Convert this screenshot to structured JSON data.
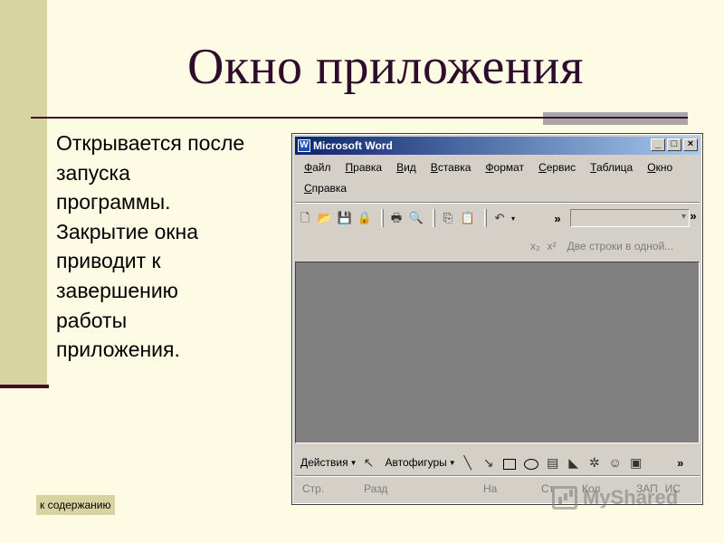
{
  "slide": {
    "title": "Окно приложения",
    "body_lines": [
      "Открывается после",
      "запуска",
      "программы.",
      "Закрытие окна",
      "приводит к",
      "завершению",
      "работы",
      "приложения."
    ],
    "content_link": "к содержанию",
    "watermark": "MyShared"
  },
  "window": {
    "title": "Microsoft Word",
    "app_icon": "W",
    "buttons": {
      "minimize": "_",
      "maximize": "□",
      "close": "×"
    },
    "menu": [
      "Файл",
      "Правка",
      "Вид",
      "Вставка",
      "Формат",
      "Сервис",
      "Таблица",
      "Окно",
      "Справка"
    ],
    "toolbar": {
      "icons": [
        "new-document-icon",
        "open-folder-icon",
        "save-icon",
        "permission-icon",
        "print-icon",
        "print-preview-icon",
        "copy-icon",
        "paste-icon",
        "undo-icon"
      ],
      "overflow": "»"
    },
    "formatting_bar": {
      "subscript": "x₂",
      "superscript": "x²",
      "two_lines": "Две строки в одной..."
    },
    "drawing": {
      "actions": "Действия",
      "autoshapes": "Автофигуры"
    },
    "status": [
      "Стр.",
      "Разд",
      "На",
      "Ст",
      "Кол",
      "ЗАП",
      "ИС"
    ]
  },
  "colors": {
    "slide_background": "#fdfbe3",
    "accent_bar": "#d8d4a2",
    "title_color": "#2f0b2c",
    "titlebar_start": "#0a246a",
    "titlebar_end": "#a6caf0",
    "document_area": "#808080"
  }
}
